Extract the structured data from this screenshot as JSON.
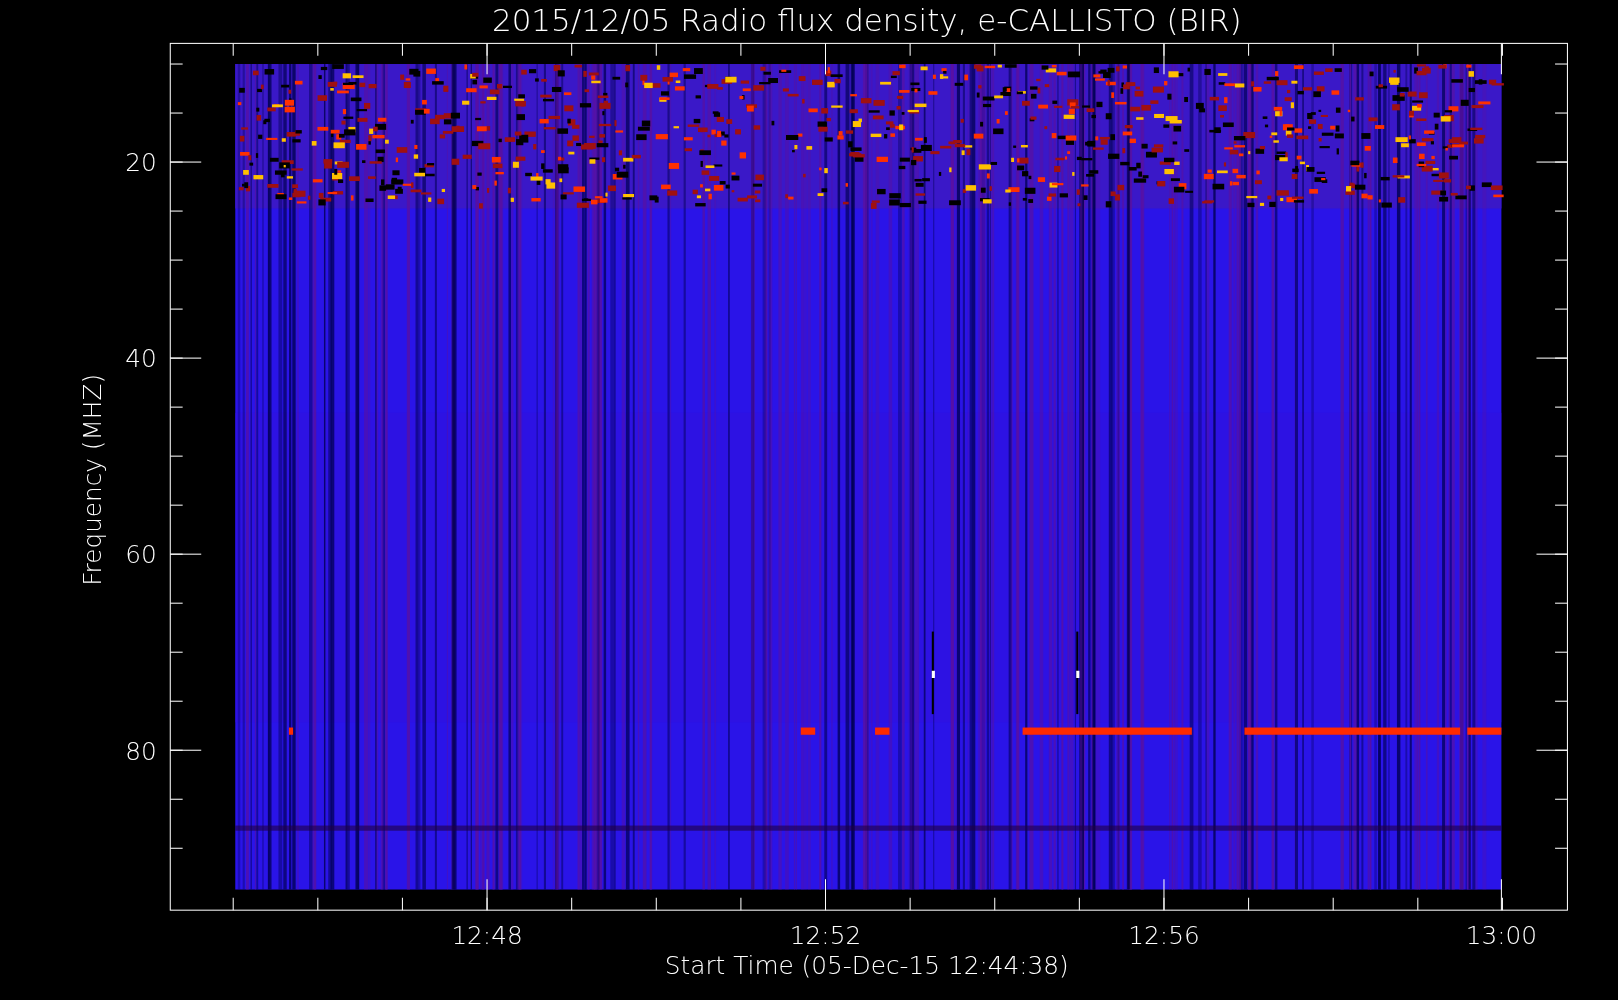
{
  "title": "2015/12/05  Radio flux density, e-CALLISTO (BIR)",
  "y_axis": {
    "label": "Frequency (MHZ)",
    "ticks": [
      "20",
      "40",
      "60",
      "80"
    ]
  },
  "x_axis": {
    "label": "Start Time (05-Dec-15 12:44:38)",
    "ticks": [
      "12:48",
      "12:52",
      "12:56",
      "13:00"
    ]
  }
}
